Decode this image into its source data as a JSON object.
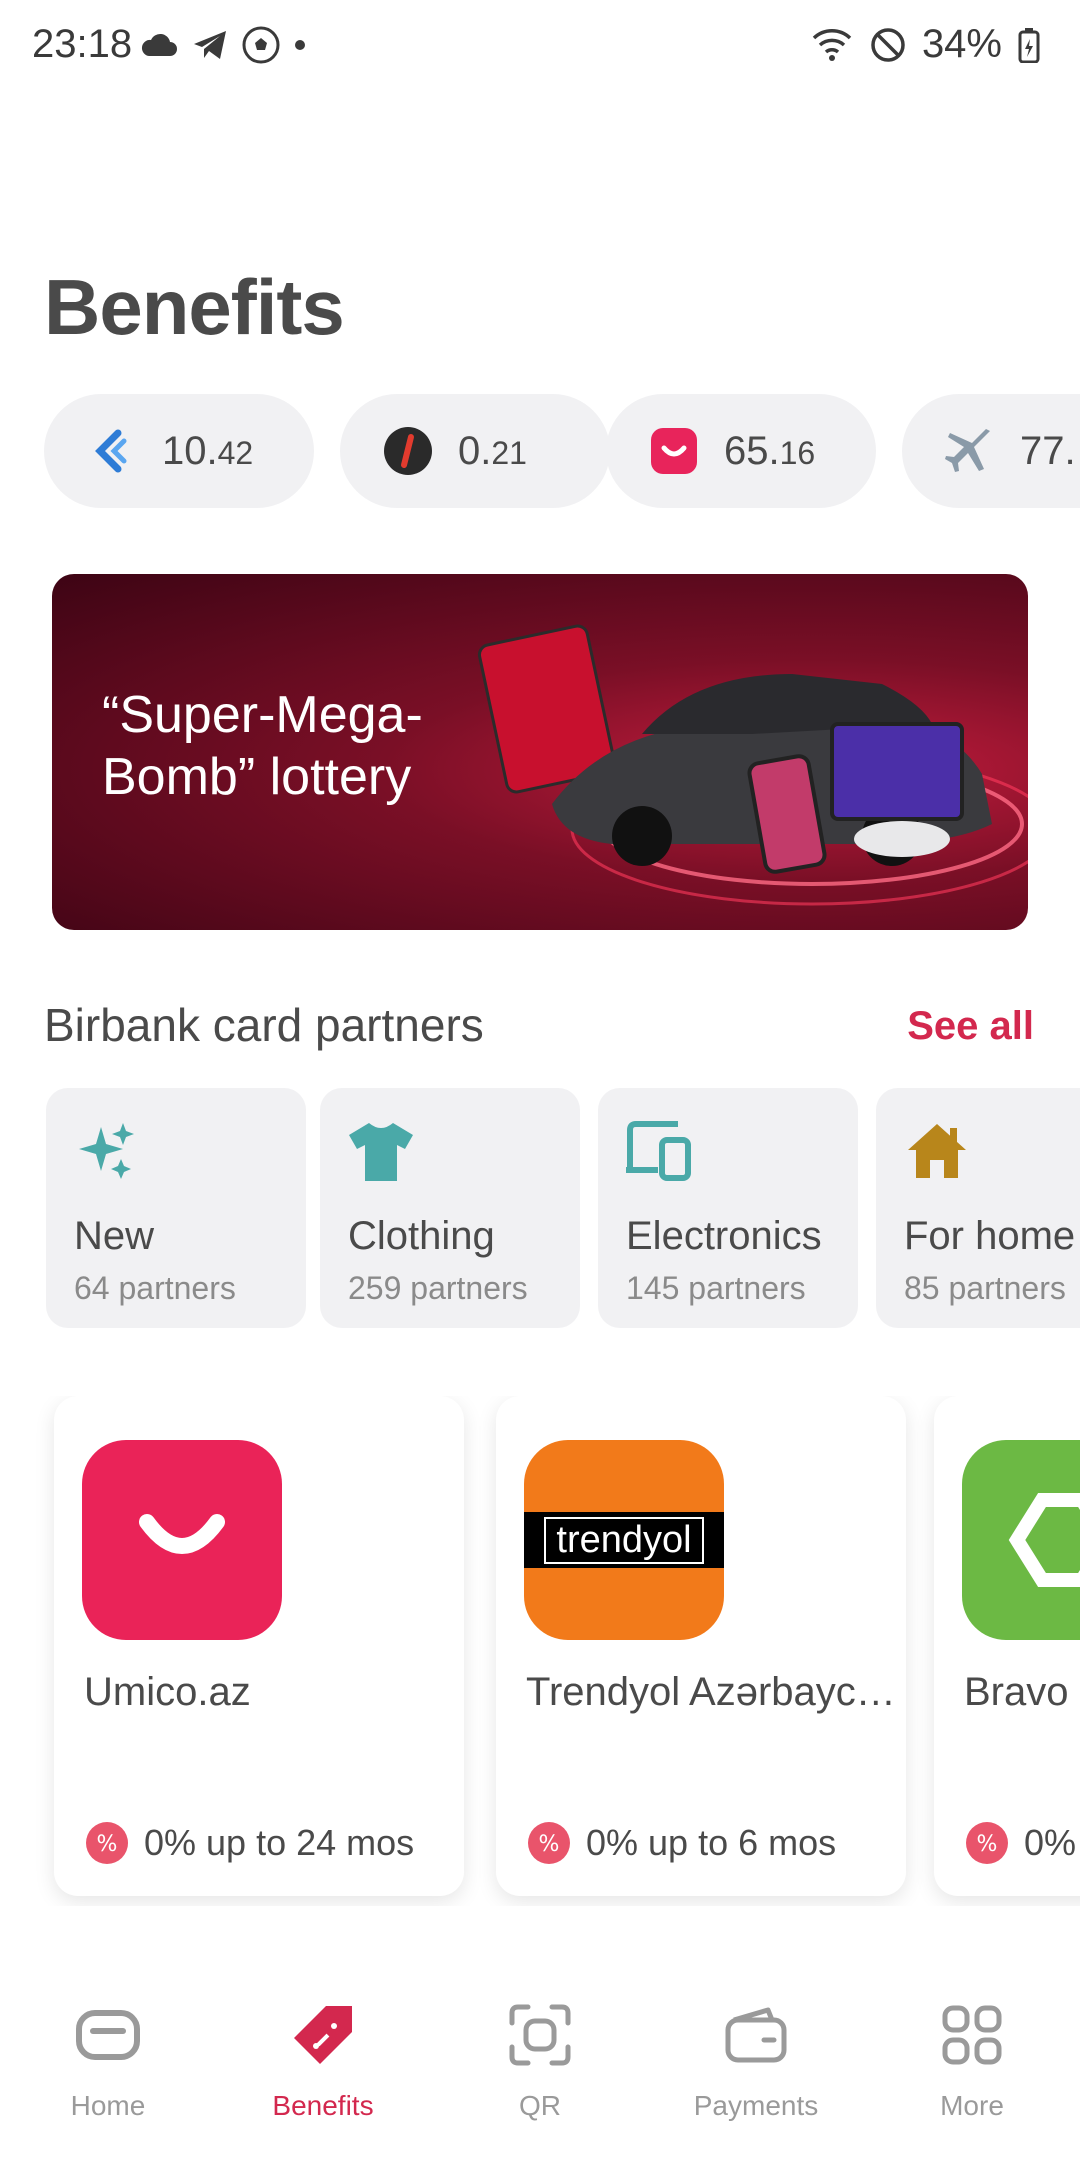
{
  "status_bar": {
    "time": "23:18",
    "battery": "34%",
    "icons": [
      "cloud-icon",
      "telegram-icon",
      "soccer-ball-icon",
      "dot-icon",
      "wifi-icon",
      "do-not-disturb-icon",
      "battery-icon"
    ]
  },
  "page": {
    "title": "Benefits"
  },
  "balances": [
    {
      "icon": "cashback-icon",
      "whole": "10.",
      "frac": "42",
      "color": "#2e7cd6"
    },
    {
      "icon": "bonus-icon",
      "whole": "0.",
      "frac": "21",
      "color": "#2a2a2a"
    },
    {
      "icon": "umico-icon",
      "whole": "65.",
      "frac": "16",
      "color": "#e8245b"
    },
    {
      "icon": "airplane-icon",
      "whole": "77.",
      "frac": "",
      "color": "#8a9aa8"
    }
  ],
  "banner": {
    "text": "“Super-Mega-Bomb” lottery"
  },
  "partners_section": {
    "title": "Birbank card partners",
    "see_all": "See all"
  },
  "categories": [
    {
      "icon": "sparkles-icon",
      "name": "New",
      "count": "64 partners"
    },
    {
      "icon": "tshirt-icon",
      "name": "Clothing",
      "count": "259 partners"
    },
    {
      "icon": "devices-icon",
      "name": "Electronics",
      "count": "145 partners"
    },
    {
      "icon": "house-icon",
      "name": "For home",
      "count": "85 partners"
    }
  ],
  "partners": [
    {
      "name": "Umico.az",
      "offer": "0% up to 24 mos"
    },
    {
      "name": "Trendyol Azərbayc…",
      "logo_text": "trendyol",
      "offer": "0% up to 6 mos"
    },
    {
      "name": "Bravo",
      "offer": "0%"
    }
  ],
  "nav": [
    {
      "icon": "home-icon",
      "label": "Home",
      "active": false
    },
    {
      "icon": "benefits-tag-icon",
      "label": "Benefits",
      "active": true
    },
    {
      "icon": "qr-scan-icon",
      "label": "QR",
      "active": false
    },
    {
      "icon": "wallet-icon",
      "label": "Payments",
      "active": false
    },
    {
      "icon": "grid-icon",
      "label": "More",
      "active": false
    }
  ],
  "colors": {
    "accent": "#d3284e",
    "teal": "#4aa9a8",
    "gold": "#b8861b"
  }
}
